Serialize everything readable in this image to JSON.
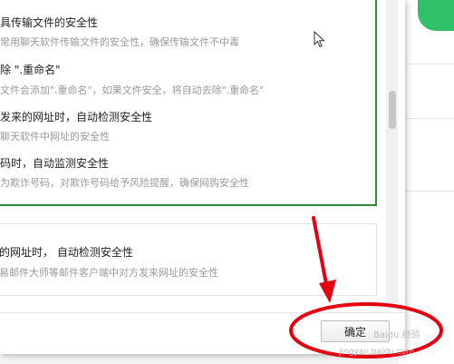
{
  "dialog": {
    "items": [
      {
        "title": "具传输文件的安全性",
        "desc": "常用聊天软件传输文件的安全性，确保传输文件不中毒"
      },
      {
        "title": "除 \".重命名\"",
        "desc": "文件会添加\".重命名\"，如果文件安全，将自动去除\".重命名\""
      },
      {
        "title": "发来的网址时，自动检测安全性",
        "desc": "聊天软件中网址的安全性"
      },
      {
        "title": "码时，自动监测安全性",
        "desc": "为欺诈号码，对欺诈号码给予风险提醒，确保网购安全性"
      },
      {
        "title": "的网址时， 自动检测安全性",
        "desc": "易邮件大师等邮件客户端中对方发来网址的安全性"
      }
    ],
    "ok_label": "确定"
  },
  "watermark": {
    "text": "Baidu 经验",
    "url": "jingyan.baidu.com"
  },
  "colors": {
    "accent_green": "#2e8b3a",
    "brand_green": "#2fc068",
    "annotation_red": "#e5000f"
  }
}
